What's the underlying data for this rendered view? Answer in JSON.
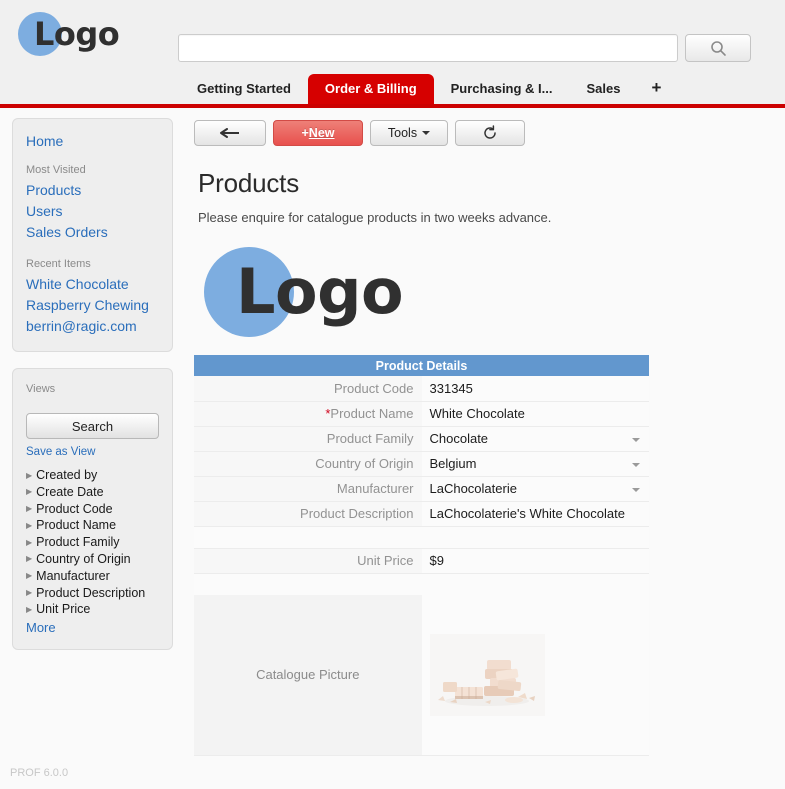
{
  "header": {
    "logo_text": "Logo",
    "logo_color": "#7dade0",
    "search": {
      "value": "",
      "placeholder": "",
      "icon": "search-icon"
    }
  },
  "tabs": {
    "items": [
      {
        "label": "Getting Started",
        "active": false
      },
      {
        "label": "Order & Billing",
        "active": true
      },
      {
        "label": "Purchasing & I...",
        "active": false
      },
      {
        "label": "Sales",
        "active": false
      }
    ],
    "add_label": "+",
    "active_color": "#d60000",
    "underline_color": "#cc0000"
  },
  "sidebar": {
    "home_label": "Home",
    "most_visited_title": "Most Visited",
    "most_visited": [
      {
        "label": "Products"
      },
      {
        "label": "Users"
      },
      {
        "label": "Sales Orders"
      }
    ],
    "recent_items_title": "Recent Items",
    "recent_items": [
      {
        "label": "White Chocolate"
      },
      {
        "label": "Raspberry Chewing"
      },
      {
        "label": "berrin@ragic.com"
      }
    ],
    "views": {
      "title": "Views",
      "search_button": "Search",
      "save_as_view": "Save as View",
      "fields": [
        {
          "label": "Created by"
        },
        {
          "label": "Create Date"
        },
        {
          "label": "Product Code"
        },
        {
          "label": "Product Name"
        },
        {
          "label": "Product Family"
        },
        {
          "label": "Country of Origin"
        },
        {
          "label": "Manufacturer"
        },
        {
          "label": "Product Description"
        },
        {
          "label": "Unit Price"
        }
      ],
      "more_label": "More"
    },
    "version": "PROF 6.0.0"
  },
  "toolbar": {
    "back_label": "←",
    "new_label": "+New",
    "new_label_plus": "+",
    "new_label_word": "New",
    "tools_label": "Tools",
    "refresh_label": "↻"
  },
  "main": {
    "page_title": "Products",
    "page_subtitle": "Please enquire for catalogue products in two weeks advance.",
    "logo_text": "Logo",
    "section_header": "Product Details",
    "fields": [
      {
        "label": "Product Code",
        "value": "331345",
        "required": false,
        "dropdown": false
      },
      {
        "label": "Product Name",
        "value": "White Chocolate",
        "required": true,
        "dropdown": false
      },
      {
        "label": "Product Family",
        "value": "Chocolate",
        "required": false,
        "dropdown": true
      },
      {
        "label": "Country of Origin",
        "value": "Belgium",
        "required": false,
        "dropdown": true
      },
      {
        "label": "Manufacturer",
        "value": "LaChocolaterie",
        "required": false,
        "dropdown": true
      },
      {
        "label": "Product Description",
        "value": "LaChocolaterie's White Chocolate",
        "required": false,
        "dropdown": false
      }
    ],
    "unit_price_label": "Unit Price",
    "unit_price_value": "$9",
    "catalogue_picture_label": "Catalogue Picture",
    "catalogue_picture_alt": "white-chocolate-pieces"
  },
  "colors": {
    "section_header_blue": "#6297ce",
    "accent_red": "#d60000",
    "link_blue": "#2a6ebb"
  }
}
